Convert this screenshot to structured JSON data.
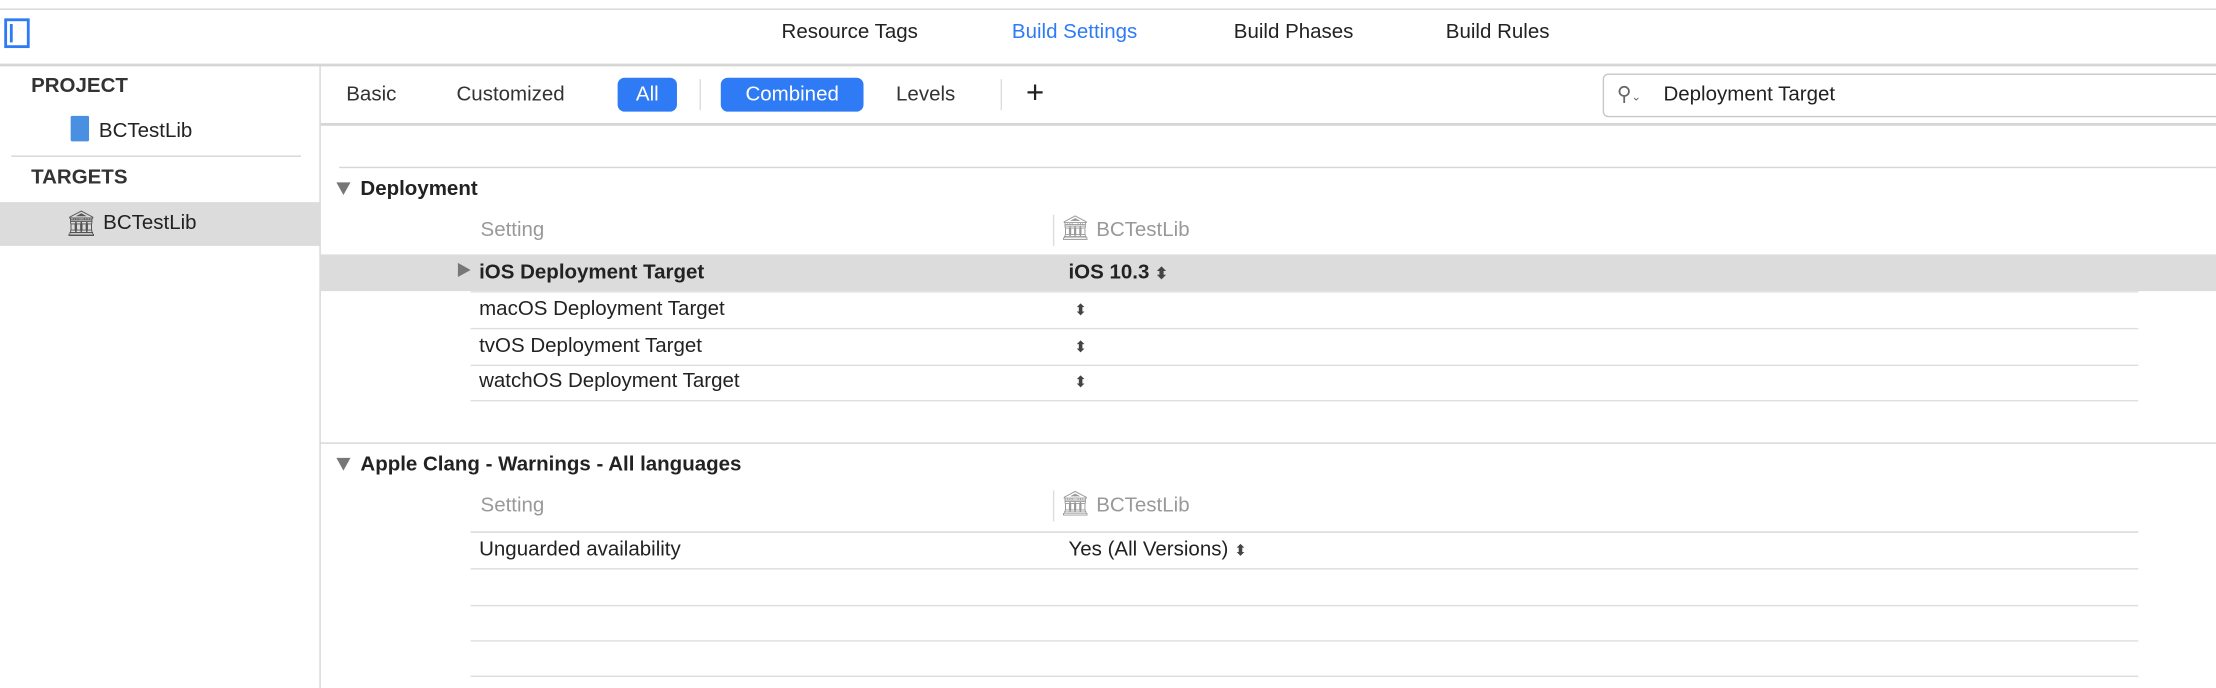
{
  "tabs": [
    {
      "label": "Resource Tags",
      "active": false
    },
    {
      "label": "Build Settings",
      "active": true
    },
    {
      "label": "Build Phases",
      "active": false
    },
    {
      "label": "Build Rules",
      "active": false
    }
  ],
  "accent": "#2f7bf5",
  "sidebar": {
    "project_header": "PROJECT",
    "project_item": "BCTestLib",
    "targets_header": "TARGETS",
    "target_item": "BCTestLib"
  },
  "filter": {
    "basic": "Basic",
    "customized": "Customized",
    "all": "All",
    "combined": "Combined",
    "levels": "Levels",
    "add": "+",
    "search_value": "Deployment Target"
  },
  "sections": [
    {
      "title": "Deployment",
      "setting_header": "Setting",
      "target_header": "BCTestLib",
      "rows": [
        {
          "name": "iOS Deployment Target",
          "value": "iOS 10.3"
        },
        {
          "name": "macOS Deployment Target",
          "value": ""
        },
        {
          "name": "tvOS Deployment Target",
          "value": ""
        },
        {
          "name": "watchOS Deployment Target",
          "value": ""
        }
      ]
    },
    {
      "title": "Apple Clang - Warnings - All languages",
      "setting_header": "Setting",
      "target_header": "BCTestLib",
      "rows": [
        {
          "name": "Unguarded availability",
          "value": "Yes (All Versions)"
        }
      ]
    }
  ]
}
